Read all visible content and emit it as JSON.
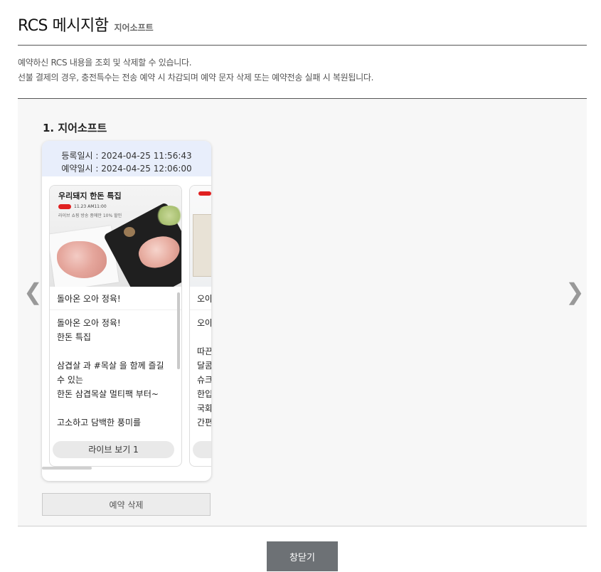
{
  "header": {
    "title": "RCS 메시지함",
    "subtitle": "지어소프트"
  },
  "description": {
    "line1": "예약하신 RCS 내용을 조회 및 삭제할 수 있습니다.",
    "line2": "선불 결제의 경우, 충전특수는 전송 예약 시 차감되며 예약 문자 삭제 또는 예약전송 실패 시 복원됩니다."
  },
  "reservation": {
    "company_label": "1. 지어소프트",
    "registered": "등록일시 : 2024-04-25 11:56:43",
    "scheduled": "예약일시 : 2024-04-25 12:06:00",
    "messages": [
      {
        "image_title": "우리돼지 한돈 특집",
        "image_tag": "11.23 AM11:00",
        "image_small": "라이브 쇼핑 방송 중에만 10% 할인",
        "heading": "돌아온 오아 정육!",
        "body": "돌아온 오아 정육!\n한돈 특집\n\n삼겹살 과 #목살 을 함께 즐길 수 있는\n한돈 삼겹목살 멀티팩 부터~\n\n고소하고 담백한 풍미를\n",
        "button_label": "라이브 보기 1"
      },
      {
        "heading": "오아",
        "body": "오아\n\n따끈\n달콤\n슈크\n한입\n국화\n간편\n",
        "button_label": ""
      }
    ],
    "delete_label": "예약 삭제"
  },
  "footer": {
    "close_label": "창닫기"
  },
  "nav": {
    "prev_icon": "❮",
    "next_icon": "❯"
  },
  "colors": {
    "card_header_bg": "#e8eefb",
    "close_button_bg": "#6d7175",
    "panel_bg": "#f7f7f7"
  }
}
